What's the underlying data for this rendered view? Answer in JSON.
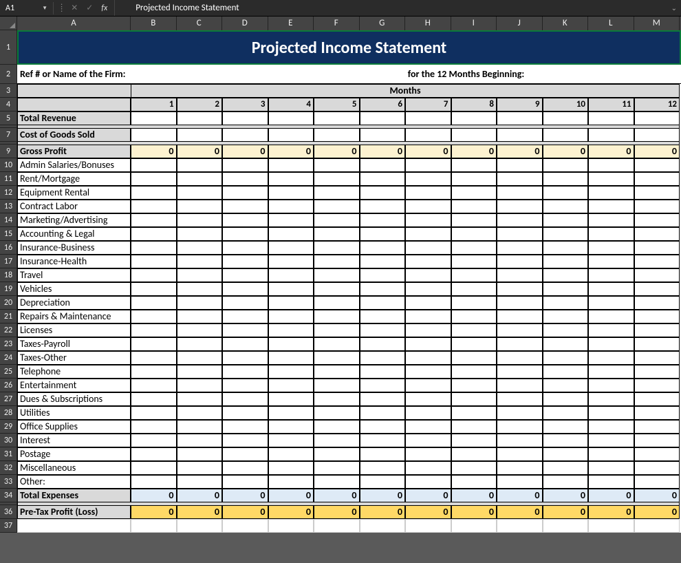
{
  "namebox": "A1",
  "formula_text": "Projected Income Statement",
  "columns": [
    "A",
    "B",
    "C",
    "D",
    "E",
    "F",
    "G",
    "H",
    "I",
    "J",
    "K",
    "L",
    "M"
  ],
  "title": "Projected Income Statement",
  "hdr_left": "Ref # or Name of the Firm:",
  "hdr_right": "for the 12 Months Beginning:",
  "months_label": "Months",
  "month_nums": [
    "1",
    "2",
    "3",
    "4",
    "5",
    "6",
    "7",
    "8",
    "9",
    "10",
    "11",
    "12"
  ],
  "rows": [
    {
      "num": "5",
      "label": "Total Revenue",
      "bold": true,
      "labelbg": "gray",
      "valbg": "",
      "vals": [
        "",
        "",
        "",
        "",
        "",
        "",
        "",
        "",
        "",
        "",
        "",
        ""
      ]
    },
    {
      "num": "7",
      "label": "Cost of Goods Sold",
      "bold": true,
      "labelbg": "gray",
      "valbg": "",
      "vals": [
        "",
        "",
        "",
        "",
        "",
        "",
        "",
        "",
        "",
        "",
        "",
        ""
      ]
    },
    {
      "num": "9",
      "label": "Gross Profit",
      "bold": true,
      "labelbg": "gray",
      "valbg": "cream",
      "vals": [
        "0",
        "0",
        "0",
        "0",
        "0",
        "0",
        "0",
        "0",
        "0",
        "0",
        "0",
        "0"
      ]
    },
    {
      "num": "10",
      "label": "Admin Salaries/Bonuses",
      "bold": false,
      "labelbg": "",
      "valbg": "",
      "vals": [
        "",
        "",
        "",
        "",
        "",
        "",
        "",
        "",
        "",
        "",
        "",
        ""
      ]
    },
    {
      "num": "11",
      "label": "Rent/Mortgage",
      "bold": false,
      "labelbg": "",
      "valbg": "",
      "vals": [
        "",
        "",
        "",
        "",
        "",
        "",
        "",
        "",
        "",
        "",
        "",
        ""
      ]
    },
    {
      "num": "12",
      "label": "Equipment Rental",
      "bold": false,
      "labelbg": "",
      "valbg": "",
      "vals": [
        "",
        "",
        "",
        "",
        "",
        "",
        "",
        "",
        "",
        "",
        "",
        ""
      ]
    },
    {
      "num": "13",
      "label": "Contract Labor",
      "bold": false,
      "labelbg": "",
      "valbg": "",
      "vals": [
        "",
        "",
        "",
        "",
        "",
        "",
        "",
        "",
        "",
        "",
        "",
        ""
      ]
    },
    {
      "num": "14",
      "label": "Marketing/Advertising",
      "bold": false,
      "labelbg": "",
      "valbg": "",
      "vals": [
        "",
        "",
        "",
        "",
        "",
        "",
        "",
        "",
        "",
        "",
        "",
        ""
      ]
    },
    {
      "num": "15",
      "label": "Accounting & Legal",
      "bold": false,
      "labelbg": "",
      "valbg": "",
      "vals": [
        "",
        "",
        "",
        "",
        "",
        "",
        "",
        "",
        "",
        "",
        "",
        ""
      ]
    },
    {
      "num": "16",
      "label": "Insurance-Business",
      "bold": false,
      "labelbg": "",
      "valbg": "",
      "vals": [
        "",
        "",
        "",
        "",
        "",
        "",
        "",
        "",
        "",
        "",
        "",
        ""
      ]
    },
    {
      "num": "17",
      "label": "Insurance-Health",
      "bold": false,
      "labelbg": "",
      "valbg": "",
      "vals": [
        "",
        "",
        "",
        "",
        "",
        "",
        "",
        "",
        "",
        "",
        "",
        ""
      ]
    },
    {
      "num": "18",
      "label": "Travel",
      "bold": false,
      "labelbg": "",
      "valbg": "",
      "vals": [
        "",
        "",
        "",
        "",
        "",
        "",
        "",
        "",
        "",
        "",
        "",
        ""
      ]
    },
    {
      "num": "19",
      "label": "Vehicles",
      "bold": false,
      "labelbg": "",
      "valbg": "",
      "vals": [
        "",
        "",
        "",
        "",
        "",
        "",
        "",
        "",
        "",
        "",
        "",
        ""
      ]
    },
    {
      "num": "20",
      "label": "Depreciation",
      "bold": false,
      "labelbg": "",
      "valbg": "",
      "vals": [
        "",
        "",
        "",
        "",
        "",
        "",
        "",
        "",
        "",
        "",
        "",
        ""
      ]
    },
    {
      "num": "21",
      "label": "Repairs & Maintenance",
      "bold": false,
      "labelbg": "",
      "valbg": "",
      "vals": [
        "",
        "",
        "",
        "",
        "",
        "",
        "",
        "",
        "",
        "",
        "",
        ""
      ]
    },
    {
      "num": "22",
      "label": "Licenses",
      "bold": false,
      "labelbg": "",
      "valbg": "",
      "vals": [
        "",
        "",
        "",
        "",
        "",
        "",
        "",
        "",
        "",
        "",
        "",
        ""
      ]
    },
    {
      "num": "23",
      "label": "Taxes-Payroll",
      "bold": false,
      "labelbg": "",
      "valbg": "",
      "vals": [
        "",
        "",
        "",
        "",
        "",
        "",
        "",
        "",
        "",
        "",
        "",
        ""
      ]
    },
    {
      "num": "24",
      "label": "Taxes-Other",
      "bold": false,
      "labelbg": "",
      "valbg": "",
      "vals": [
        "",
        "",
        "",
        "",
        "",
        "",
        "",
        "",
        "",
        "",
        "",
        ""
      ]
    },
    {
      "num": "25",
      "label": "Telephone",
      "bold": false,
      "labelbg": "",
      "valbg": "",
      "vals": [
        "",
        "",
        "",
        "",
        "",
        "",
        "",
        "",
        "",
        "",
        "",
        ""
      ]
    },
    {
      "num": "26",
      "label": "Entertainment",
      "bold": false,
      "labelbg": "",
      "valbg": "",
      "vals": [
        "",
        "",
        "",
        "",
        "",
        "",
        "",
        "",
        "",
        "",
        "",
        ""
      ]
    },
    {
      "num": "27",
      "label": "Dues & Subscriptions",
      "bold": false,
      "labelbg": "",
      "valbg": "",
      "vals": [
        "",
        "",
        "",
        "",
        "",
        "",
        "",
        "",
        "",
        "",
        "",
        ""
      ]
    },
    {
      "num": "28",
      "label": "Utilities",
      "bold": false,
      "labelbg": "",
      "valbg": "",
      "vals": [
        "",
        "",
        "",
        "",
        "",
        "",
        "",
        "",
        "",
        "",
        "",
        ""
      ]
    },
    {
      "num": "29",
      "label": "Office Supplies",
      "bold": false,
      "labelbg": "",
      "valbg": "",
      "vals": [
        "",
        "",
        "",
        "",
        "",
        "",
        "",
        "",
        "",
        "",
        "",
        ""
      ]
    },
    {
      "num": "30",
      "label": "Interest",
      "bold": false,
      "labelbg": "",
      "valbg": "",
      "vals": [
        "",
        "",
        "",
        "",
        "",
        "",
        "",
        "",
        "",
        "",
        "",
        ""
      ]
    },
    {
      "num": "31",
      "label": "Postage",
      "bold": false,
      "labelbg": "",
      "valbg": "",
      "vals": [
        "",
        "",
        "",
        "",
        "",
        "",
        "",
        "",
        "",
        "",
        "",
        ""
      ]
    },
    {
      "num": "32",
      "label": "Miscellaneous",
      "bold": false,
      "labelbg": "",
      "valbg": "",
      "vals": [
        "",
        "",
        "",
        "",
        "",
        "",
        "",
        "",
        "",
        "",
        "",
        ""
      ]
    },
    {
      "num": "33",
      "label": "Other:",
      "bold": false,
      "labelbg": "",
      "valbg": "",
      "vals": [
        "",
        "",
        "",
        "",
        "",
        "",
        "",
        "",
        "",
        "",
        "",
        ""
      ]
    },
    {
      "num": "34",
      "label": "Total Expenses",
      "bold": true,
      "labelbg": "gray",
      "valbg": "lightblue",
      "vals": [
        "0",
        "0",
        "0",
        "0",
        "0",
        "0",
        "0",
        "0",
        "0",
        "0",
        "0",
        "0"
      ]
    },
    {
      "num": "36",
      "label": "Pre-Tax Profit (Loss)",
      "bold": true,
      "labelbg": "gray",
      "valbg": "gold",
      "vals": [
        "0",
        "0",
        "0",
        "0",
        "0",
        "0",
        "0",
        "0",
        "0",
        "0",
        "0",
        "0"
      ]
    }
  ]
}
